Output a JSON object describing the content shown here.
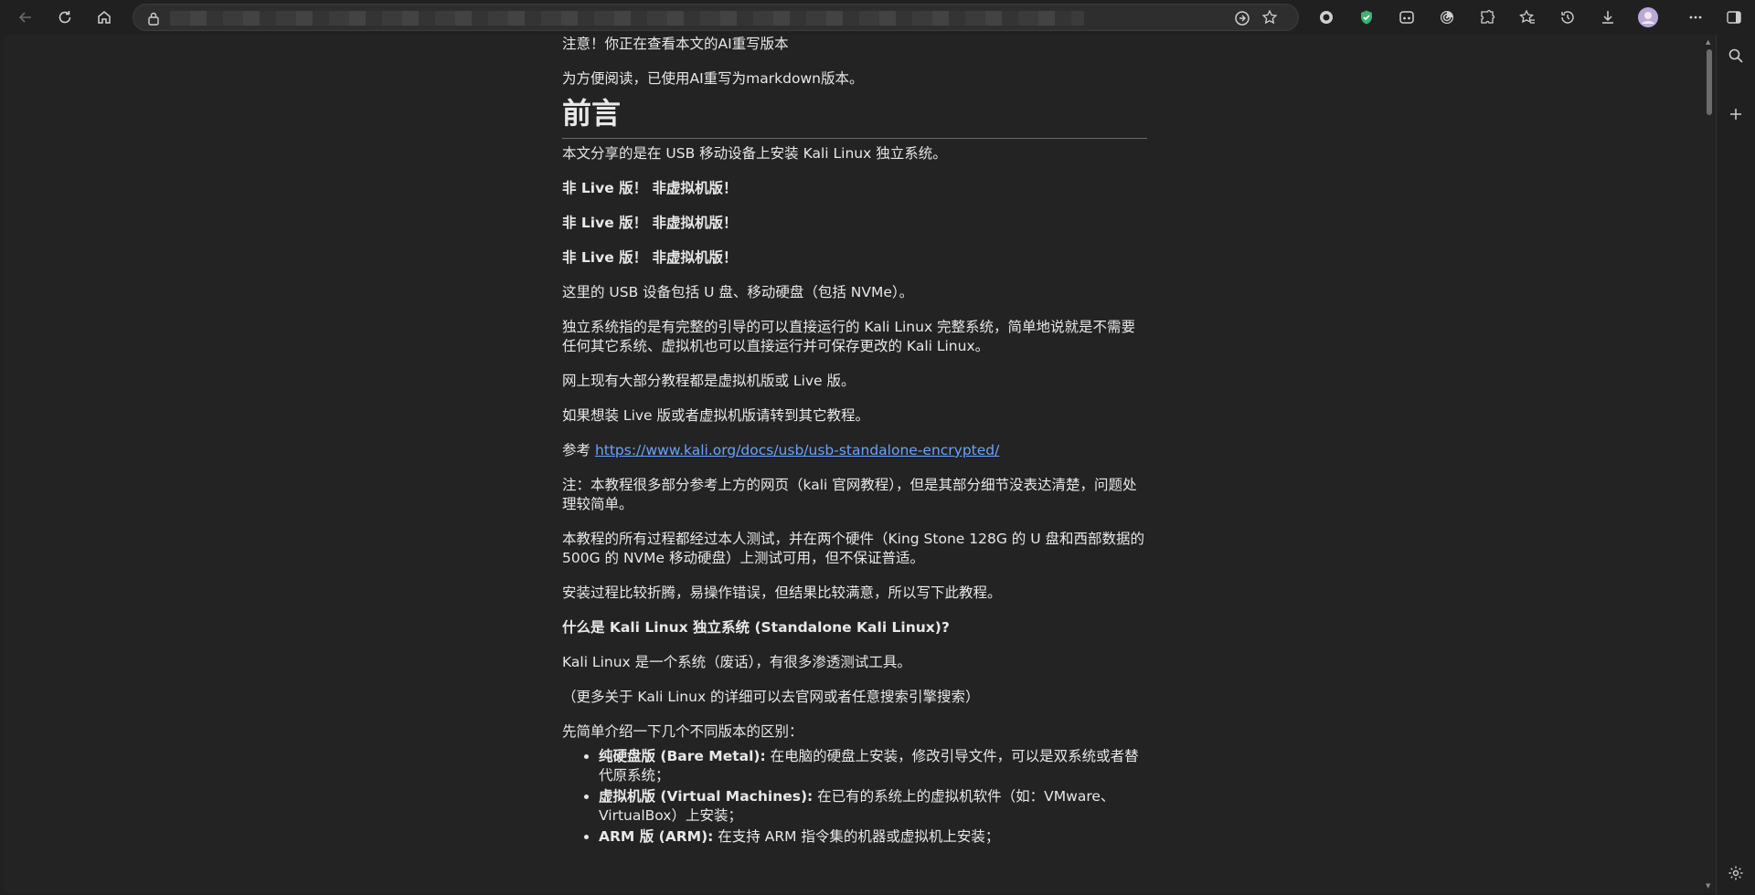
{
  "article": {
    "notice": "注意！你正在查看本文的AI重写版本",
    "rewrite_note": "为方便阅读，已使用AI重写为markdown版本。",
    "heading": "前言",
    "intro": "本文分享的是在 USB 移动设备上安装 Kali Linux 独立系统。",
    "emphasis": [
      "非 Live 版！ 非虚拟机版！",
      "非 Live 版！ 非虚拟机版！",
      "非 Live 版！ 非虚拟机版！"
    ],
    "usb_devices": "这里的 USB 设备包括 U 盘、移动硬盘（包括 NVMe）。",
    "standalone_def": "独立系统指的是有完整的引导的可以直接运行的 Kali Linux 完整系统，简单地说就是不需要任何其它系统、虚拟机也可以直接运行并可保存更改的 Kali Linux。",
    "online_tutorials": "网上现有大部分教程都是虚拟机版或 Live 版。",
    "other_tutorials": "如果想装 Live 版或者虚拟机版请转到其它教程。",
    "reference_prefix": "参考 ",
    "reference_url": "https://www.kali.org/docs/usb/usb-standalone-encrypted/",
    "note": "注：本教程很多部分参考上方的网页（kali 官网教程），但是其部分细节没表达清楚，问题处理较简单。",
    "tested": "本教程的所有过程都经过本人测试，并在两个硬件（King Stone 128G 的 U 盘和西部数据的 500G 的 NVMe 移动硬盘）上测试可用，但不保证普适。",
    "process": "安装过程比较折腾，易操作错误，但结果比较满意，所以写下此教程。",
    "question": "什么是 Kali Linux 独立系统 (Standalone Kali Linux)?",
    "kali_desc": "Kali Linux 是一个系统（废话），有很多渗透测试工具。",
    "more_info": "（更多关于 Kali Linux 的详细可以去官网或者任意搜索引擎搜索）",
    "versions_intro": "先简单介绍一下几个不同版本的区别：",
    "versions": [
      {
        "name": "纯硬盘版 (Bare Metal):",
        "desc": " 在电脑的硬盘上安装，修改引导文件，可以是双系统或者替代原系统；"
      },
      {
        "name": "虚拟机版 (Virtual Machines):",
        "desc": " 在已有的系统上的虚拟机软件（如：VMware、VirtualBox）上安装；"
      },
      {
        "name": "ARM 版 (ARM):",
        "desc": " 在支持 ARM 指令集的机器或虚拟机上安装；"
      }
    ]
  },
  "icons": {
    "toolbar": [
      "back-icon",
      "refresh-icon",
      "home-icon",
      "lock-icon",
      "read-aloud-icon",
      "favorite-star-icon"
    ],
    "extensions": [
      "record-icon",
      "shield-icon",
      "game-icon",
      "spiral-icon",
      "extensions-icon",
      "favorites-icon",
      "history-icon",
      "downloads-icon",
      "profile-avatar",
      "more-icon",
      "sidebar-icon"
    ],
    "rail": [
      "search-icon",
      "add-icon",
      "settings-icon"
    ]
  },
  "colors": {
    "background": "#232323",
    "link": "#6aa2ff",
    "shield": "#3cb371"
  }
}
